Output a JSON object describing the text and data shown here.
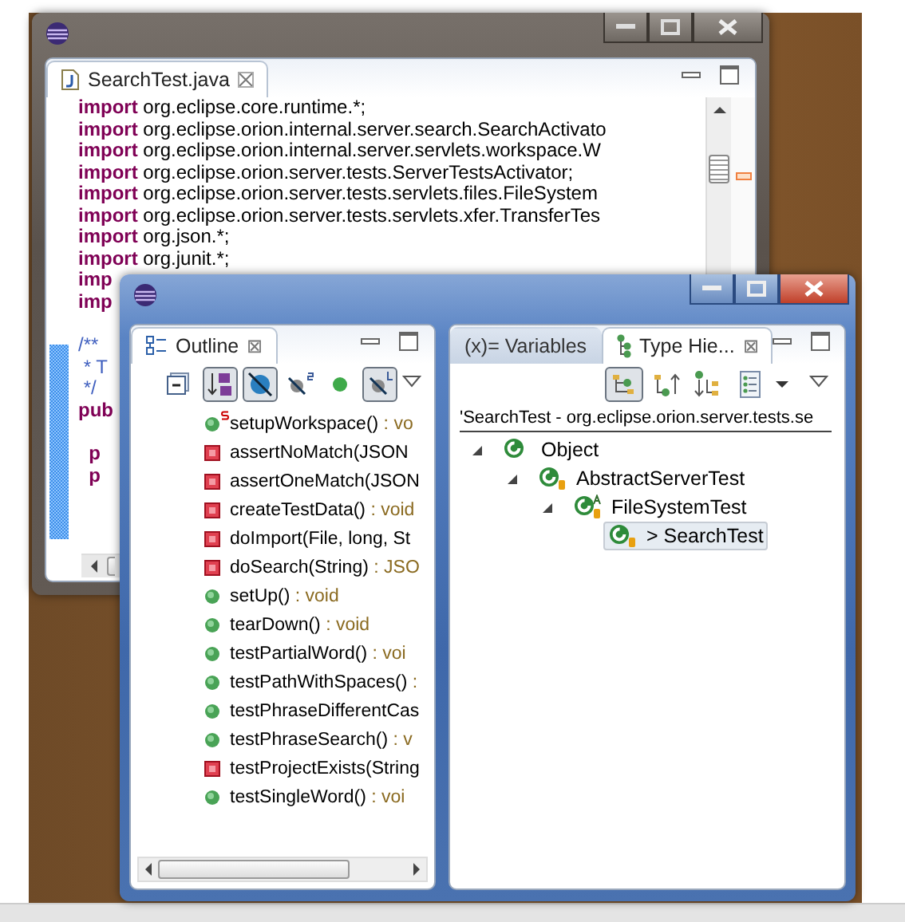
{
  "editor_window": {
    "tab": {
      "label": "SearchTest.java",
      "selected": true
    },
    "lines": [
      {
        "tokens": [
          {
            "kind": "keyword",
            "text": "import"
          },
          {
            "kind": "plain",
            "text": " org.eclipse.core.runtime.*;"
          }
        ]
      },
      {
        "tokens": [
          {
            "kind": "keyword",
            "text": "import"
          },
          {
            "kind": "plain",
            "text": " org.eclipse.orion.internal.server.search.SearchActivato"
          }
        ]
      },
      {
        "tokens": [
          {
            "kind": "keyword",
            "text": "import"
          },
          {
            "kind": "plain",
            "text": " org.eclipse.orion.internal.server.servlets.workspace.W"
          }
        ]
      },
      {
        "tokens": [
          {
            "kind": "keyword",
            "text": "import"
          },
          {
            "kind": "plain",
            "text": " org.eclipse.orion.server.tests.ServerTestsActivator;"
          }
        ]
      },
      {
        "tokens": [
          {
            "kind": "keyword",
            "text": "import"
          },
          {
            "kind": "plain",
            "text": " org.eclipse.orion.server.tests.servlets.files.FileSystem"
          }
        ]
      },
      {
        "tokens": [
          {
            "kind": "keyword",
            "text": "import"
          },
          {
            "kind": "plain",
            "text": " org.eclipse.orion.server.tests.servlets.xfer.TransferTes"
          }
        ]
      },
      {
        "tokens": [
          {
            "kind": "keyword",
            "text": "import"
          },
          {
            "kind": "plain",
            "text": " org.json.*;"
          }
        ]
      },
      {
        "tokens": [
          {
            "kind": "keyword",
            "text": "import"
          },
          {
            "kind": "plain",
            "text": " org.junit.*;"
          }
        ]
      },
      {
        "tokens": [
          {
            "kind": "keyword",
            "text": "imp"
          }
        ]
      },
      {
        "tokens": [
          {
            "kind": "keyword",
            "text": "imp"
          }
        ]
      },
      {
        "space_before": true,
        "tokens": [
          {
            "kind": "comment",
            "text": "/**"
          }
        ]
      },
      {
        "tokens": [
          {
            "kind": "comment",
            "text": " * T"
          }
        ]
      },
      {
        "tokens": [
          {
            "kind": "comment",
            "text": " */"
          }
        ]
      },
      {
        "tokens": [
          {
            "kind": "keyword",
            "text": "pub"
          }
        ]
      },
      {
        "space_before": true,
        "tokens": [
          {
            "kind": "keyword",
            "text": "  p"
          }
        ]
      },
      {
        "tokens": [
          {
            "kind": "keyword",
            "text": "  p"
          }
        ]
      }
    ]
  },
  "outline_window": {
    "outline": {
      "tab": {
        "label": "Outline",
        "close": "⊠",
        "selected": true
      },
      "toolbar": [
        {
          "kind": "collapse",
          "pressed": false
        },
        {
          "kind": "sort",
          "pressed": true
        },
        {
          "kind": "hide-fields",
          "pressed": true
        },
        {
          "kind": "hide-static",
          "pressed": false
        },
        {
          "kind": "hide-nonpublic",
          "pressed": false
        },
        {
          "kind": "hide-local",
          "pressed": true
        }
      ],
      "items": [
        {
          "name": "setupWorkspace()",
          "type": " : vo",
          "kind": "public",
          "static": true
        },
        {
          "name": "assertNoMatch(JSON",
          "kind": "private",
          "static": false
        },
        {
          "name": "assertOneMatch(JSON",
          "kind": "private",
          "static": false
        },
        {
          "name": "createTestData()",
          "type": " : void",
          "kind": "private",
          "static": false
        },
        {
          "name": "doImport(File, long, St",
          "kind": "private",
          "static": false
        },
        {
          "name": "doSearch(String)",
          "type": " : JSO",
          "kind": "private",
          "static": false
        },
        {
          "name": "setUp()",
          "type": " : void",
          "kind": "public",
          "static": false
        },
        {
          "name": "tearDown()",
          "type": " : void",
          "kind": "public",
          "static": false
        },
        {
          "name": "testPartialWord()",
          "type": " : voi",
          "kind": "public",
          "static": false
        },
        {
          "name": "testPathWithSpaces()",
          "type": " :",
          "kind": "public",
          "static": false
        },
        {
          "name": "testPhraseDifferentCas",
          "kind": "public",
          "static": false
        },
        {
          "name": "testPhraseSearch()",
          "type": " : v",
          "kind": "public",
          "static": false
        },
        {
          "name": "testProjectExists(String",
          "kind": "private",
          "static": false
        },
        {
          "name": "testSingleWord()",
          "type": " : voi",
          "kind": "public",
          "static": false
        }
      ]
    },
    "hierarchy": {
      "tabs": [
        {
          "label": "(x)= Variables",
          "selected": false
        },
        {
          "label": "Type Hie...",
          "close": "⊠",
          "selected": true
        }
      ],
      "toolbar": [
        {
          "kind": "hierarchy",
          "pressed": true
        },
        {
          "kind": "supertypes",
          "pressed": false
        },
        {
          "kind": "subtypes",
          "pressed": false
        },
        {
          "kind": "layout",
          "pressed": false
        }
      ],
      "header": "'SearchTest - org.eclipse.orion.server.tests.se",
      "tree": [
        {
          "label": "Object",
          "selected": false,
          "expanded": true,
          "abstract": false,
          "children": [
            {
              "label": "AbstractServerTest",
              "selected": false,
              "expanded": true,
              "abstract": false,
              "children": [
                {
                  "label": "FileSystemTest",
                  "selected": false,
                  "expanded": true,
                  "abstract": true,
                  "children": [
                    {
                      "label": "> SearchTest",
                      "selected": true,
                      "expanded": false,
                      "abstract": false
                    }
                  ]
                }
              ]
            }
          ]
        }
      ]
    }
  }
}
